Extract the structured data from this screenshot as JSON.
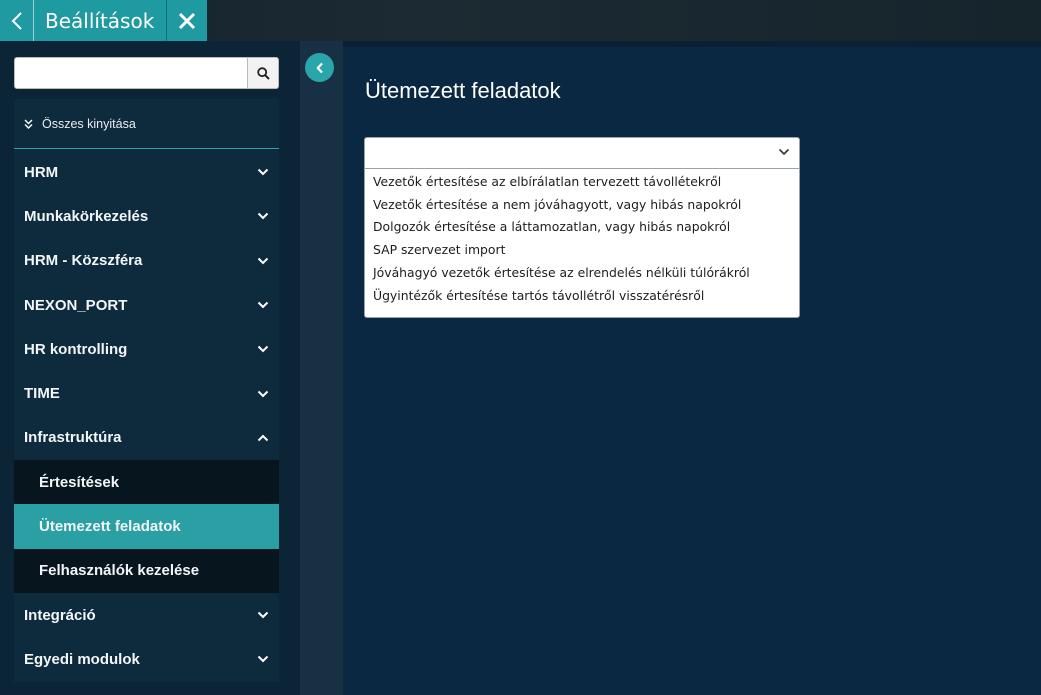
{
  "topbar": {
    "back_icon": "chevron-left-icon",
    "title": "Beállítások",
    "close_icon": "close-icon",
    "accent_color": "#1f9aa0"
  },
  "sidebar": {
    "search": {
      "value": "",
      "placeholder": "",
      "icon": "search-icon"
    },
    "expand_all": {
      "label": "Összes kinyitása",
      "icon": "double-chevron-down-icon"
    },
    "items": [
      {
        "label": "HRM",
        "expanded": false
      },
      {
        "label": "Munkakörkezelés",
        "expanded": false
      },
      {
        "label": "HRM - Közszféra",
        "expanded": false
      },
      {
        "label": "NEXON_PORT",
        "expanded": false
      },
      {
        "label": "HR kontrolling",
        "expanded": false
      },
      {
        "label": "TIME",
        "expanded": false
      },
      {
        "label": "Infrastruktúra",
        "expanded": true,
        "children": [
          {
            "label": "Értesítések",
            "active": false
          },
          {
            "label": "Ütemezett feladatok",
            "active": true
          },
          {
            "label": "Felhasználók kezelése",
            "active": false
          }
        ]
      },
      {
        "label": "Integráció",
        "expanded": false
      },
      {
        "label": "Egyedi modulok",
        "expanded": false
      }
    ],
    "active_color": "#2a9fa4"
  },
  "collapse_button": {
    "icon": "chevron-left-icon"
  },
  "main": {
    "title": "Ütemezett feladatok",
    "select": {
      "value": "",
      "icon": "chevron-down-icon",
      "options": [
        "Vezetők értesítése az elbírálatlan tervezett távollétekről",
        "Vezetők értesítése a nem jóváhagyott, vagy hibás napokról",
        "Dolgozók értesítése a láttamozatlan, vagy hibás napokról",
        "SAP szervezet import",
        "Jóváhagyó vezetők értesítése az elrendelés nélküli túlórákról",
        "Ügyintézők értesítése tartós távollétről visszatérésről"
      ]
    }
  }
}
